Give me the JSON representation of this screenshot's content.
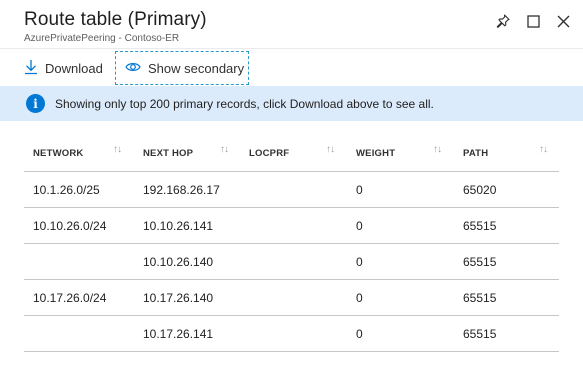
{
  "header": {
    "title": "Route table (Primary)",
    "subtitle": "AzurePrivatePeering - Contoso-ER",
    "icons": [
      "pin-icon",
      "maximize-icon",
      "close-icon"
    ]
  },
  "toolbar": {
    "download_label": "Download",
    "show_secondary_label": "Show secondary"
  },
  "info": {
    "message": "Showing only top 200 primary records, click Download above to see all.",
    "accent": "#0078d4",
    "background": "#dcebfb"
  },
  "table": {
    "columns": [
      "NETWORK",
      "NEXT HOP",
      "LOCPRF",
      "WEIGHT",
      "PATH"
    ],
    "sort_glyph": "↑↓",
    "rows": [
      {
        "network": "10.1.26.0/25",
        "next_hop": "192.168.26.17",
        "locprf": "",
        "weight": "0",
        "path": "65020"
      },
      {
        "network": "10.10.26.0/24",
        "next_hop": "10.10.26.141",
        "locprf": "",
        "weight": "0",
        "path": "65515"
      },
      {
        "network": "",
        "next_hop": "10.10.26.140",
        "locprf": "",
        "weight": "0",
        "path": "65515"
      },
      {
        "network": "10.17.26.0/24",
        "next_hop": "10.17.26.140",
        "locprf": "",
        "weight": "0",
        "path": "65515"
      },
      {
        "network": "",
        "next_hop": "10.17.26.141",
        "locprf": "",
        "weight": "0",
        "path": "65515"
      }
    ]
  }
}
